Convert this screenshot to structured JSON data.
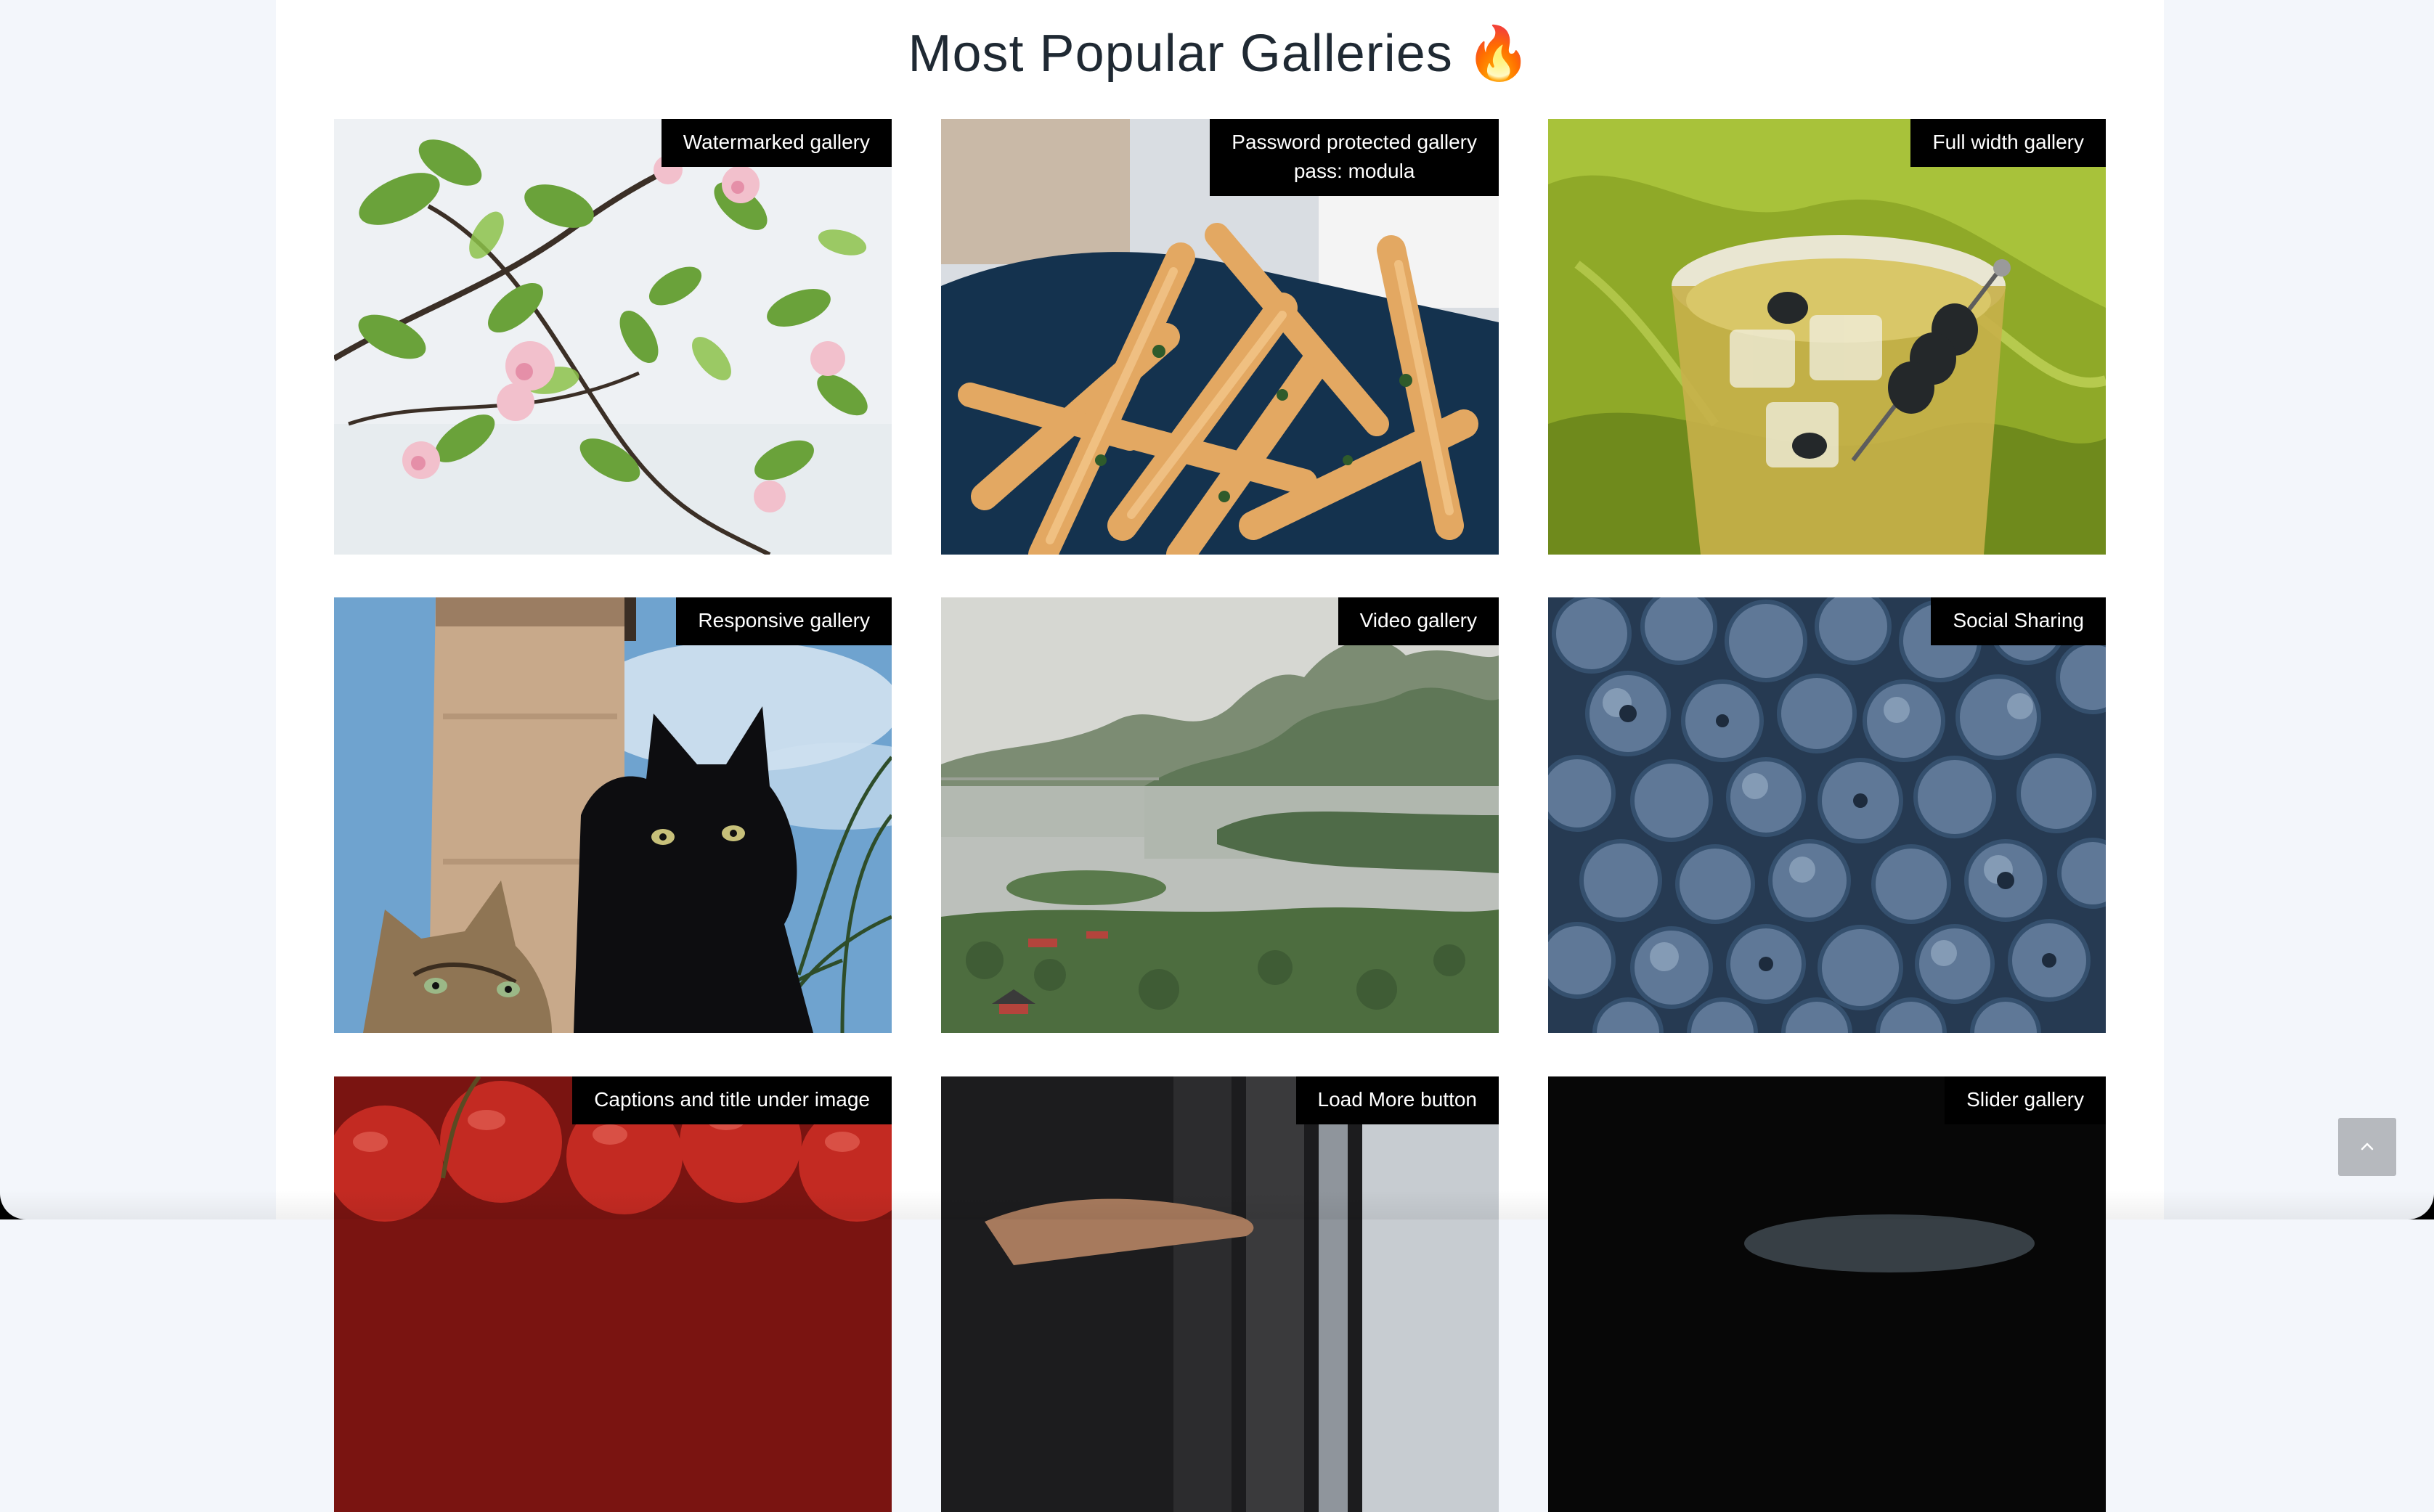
{
  "section": {
    "title": "Most Popular Galleries",
    "title_emoji": "🔥"
  },
  "galleries": [
    {
      "label": "Watermarked gallery",
      "image": "pink-blossom-branches"
    },
    {
      "label": "Password protected gallery\npass: modula",
      "image": "french-fries-closeup"
    },
    {
      "label": "Full width gallery",
      "image": "cocktail-with-olives"
    },
    {
      "label": "Responsive gallery",
      "image": "black-cat-and-tabby-cat"
    },
    {
      "label": "Video gallery",
      "image": "lake-and-mountains-landscape"
    },
    {
      "label": "Social Sharing",
      "image": "blueberries-closeup"
    },
    {
      "label": "Captions and title under image",
      "image": "red-cherries"
    },
    {
      "label": "Load More button",
      "image": "hand-in-dim-room"
    },
    {
      "label": "Slider gallery",
      "image": "dark-photo"
    }
  ],
  "controls": {
    "back_to_top_icon": "chevron-up-icon"
  },
  "colors": {
    "page_background": "#f3f6fb",
    "panel_background": "#ffffff",
    "tag_background": "#000000",
    "tag_text": "#ffffff",
    "back_to_top_background": "#b6b9be"
  }
}
